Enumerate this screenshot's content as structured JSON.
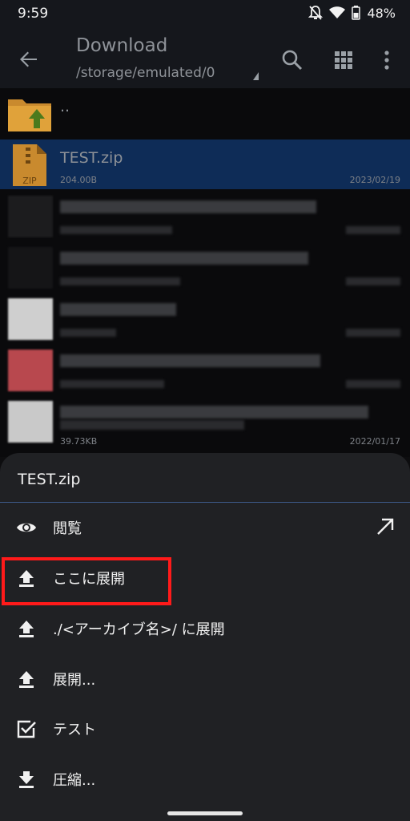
{
  "status_bar": {
    "time": "9:59",
    "battery": "48%"
  },
  "toolbar": {
    "title": "Download",
    "path": "/storage/emulated/0"
  },
  "file_list": {
    "parent": {
      "name": ".."
    },
    "selected_file": {
      "name": "TEST.zip",
      "size": "204.00B",
      "date": "2023/02/19",
      "icon_label": "ZIP"
    },
    "partial_meta": "39.73KB",
    "partial_date": "2022/01/17"
  },
  "sheet": {
    "title": "TEST.zip",
    "items": [
      {
        "label": "閲覧"
      },
      {
        "label": "ここに展開"
      },
      {
        "label": "./<アーカイブ名>/ に展開"
      },
      {
        "label": "展開..."
      },
      {
        "label": "テスト"
      },
      {
        "label": "圧縮..."
      }
    ]
  },
  "colors": {
    "selected_row": "#0e2c57",
    "highlight": "#ff1a1a",
    "sheet_bg": "#202124",
    "folder": "#c98a2e"
  }
}
